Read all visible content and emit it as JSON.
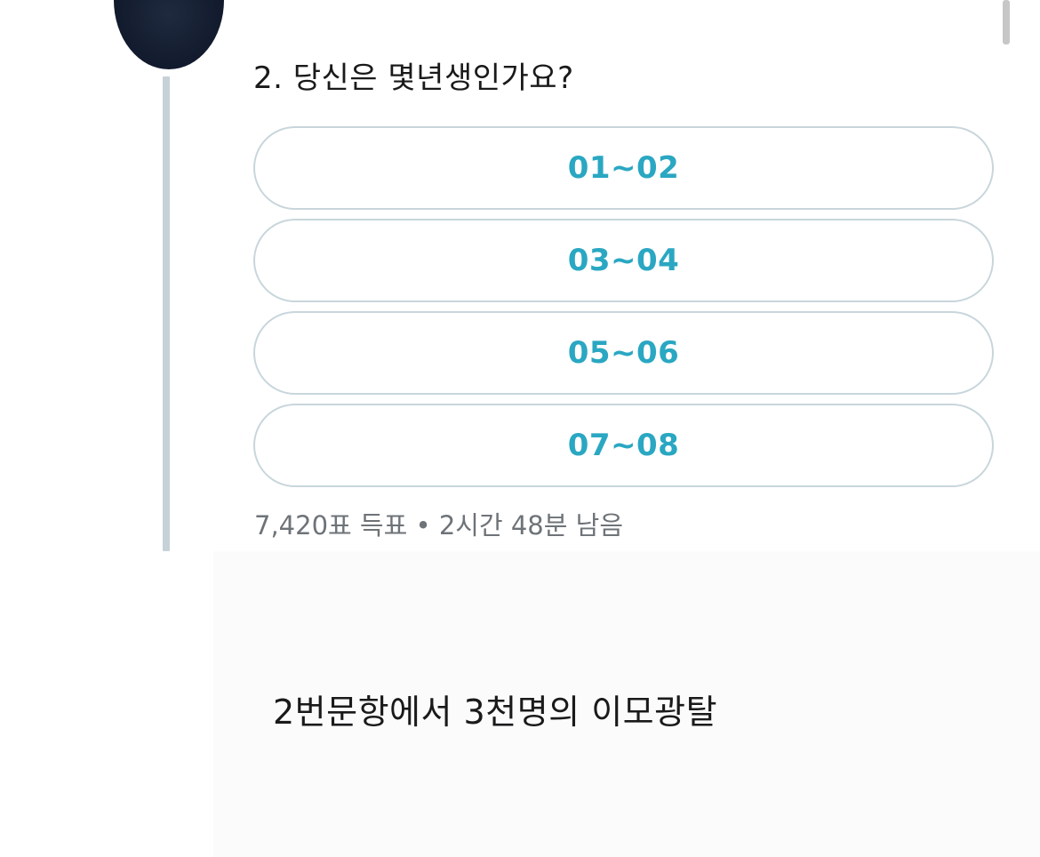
{
  "poll": {
    "question": "2. 당신은 몇년생인가요?",
    "options": [
      {
        "label": "01~02"
      },
      {
        "label": "03~04"
      },
      {
        "label": "05~06"
      },
      {
        "label": "07~08"
      }
    ],
    "meta": "7,420표 득표 • 2시간 48분 남음",
    "accent_color": "#2aa7c2",
    "border_color": "#c8d6dc"
  },
  "caption": "2번문항에서 3천명의 이모광탈"
}
